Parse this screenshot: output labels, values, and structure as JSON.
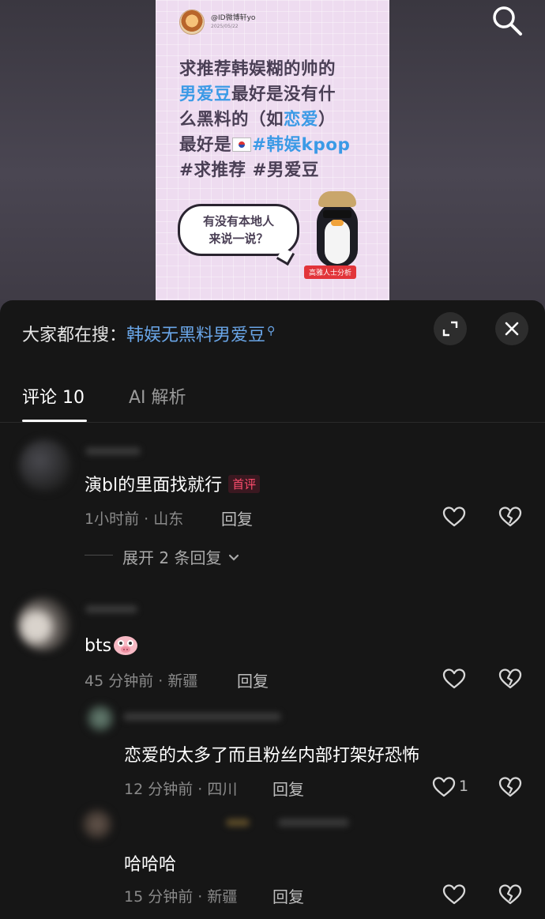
{
  "post": {
    "author": "@ID微博轩yo",
    "date": "2025/05/22",
    "line1": "求推荐韩娱糊的帅的",
    "line2_hl": "男爱豆",
    "line2_rest": "最好是没有什",
    "line3_a": "么黑料的（如",
    "line3_hl": "恋爱",
    "line3_b": "）",
    "line4_a": "最好是",
    "line4_hl": "#韩娱kpop",
    "line5": "#求推荐 #男爱豆",
    "bubble_line1": "有没有本地人",
    "bubble_line2": "来说一说？",
    "badge": "高雅人士分析"
  },
  "sheet": {
    "search_prefix": "大家都在搜：",
    "search_term": "韩娱无黑料男爱豆",
    "tabs": [
      {
        "label": "评论 10",
        "active": true
      },
      {
        "label": "AI 解析",
        "active": false
      }
    ]
  },
  "comments": [
    {
      "text": "演bl的里面找就行",
      "badge": "首评",
      "time_loc": "1小时前 · 山东",
      "reply": "回复"
    },
    {
      "text": "bts",
      "time_loc": "45 分钟前 · 新疆",
      "reply": "回复"
    }
  ],
  "expand_replies": "展开 2 条回复",
  "replies": [
    {
      "text": "恋爱的太多了而且粉丝内部打架好恐怖",
      "time_loc": "12 分钟前 · 四川",
      "reply": "回复",
      "likes": "1"
    },
    {
      "text": "哈哈哈",
      "time_loc": "15 分钟前 · 新疆",
      "reply": "回复"
    }
  ],
  "icons": {
    "search": "search-icon",
    "expand": "expand-icon",
    "close": "close-icon",
    "like": "heart-icon",
    "dislike": "broken-heart-icon",
    "chevron": "chevron-down-icon"
  },
  "colors": {
    "accent_blue": "#6aa6e8",
    "first_badge": "#ff4d6d",
    "post_bg": "#eedcf0",
    "sheet_bg": "#161616"
  }
}
